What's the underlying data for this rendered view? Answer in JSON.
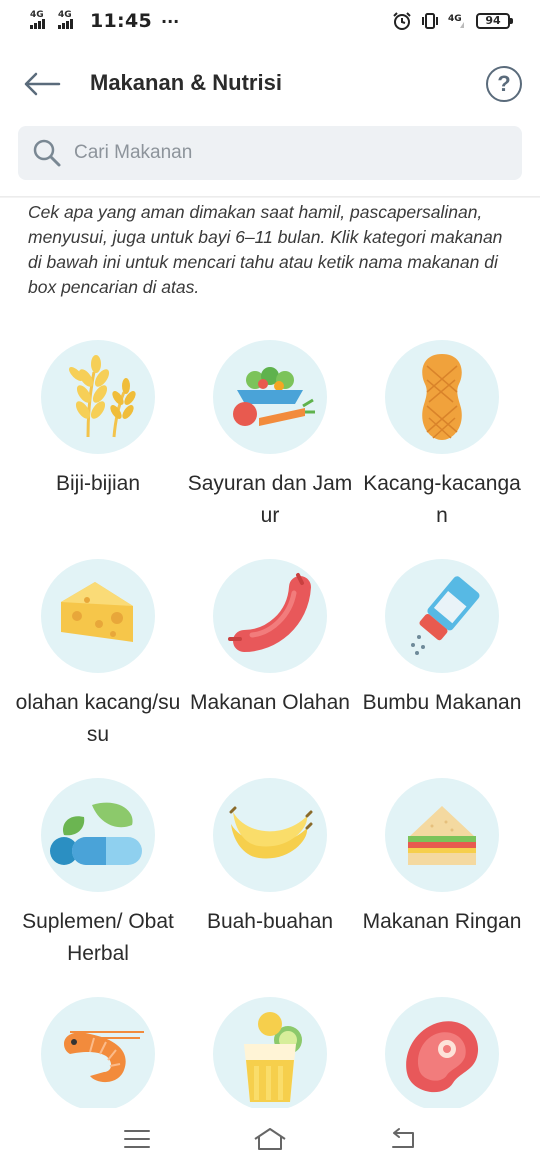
{
  "status_bar": {
    "network_1": "4G",
    "network_2": "4G",
    "time": "11:45",
    "more_dots": "···",
    "network_3": "4G",
    "battery": "94"
  },
  "header": {
    "title": "Makanan & Nutrisi",
    "help_label": "?"
  },
  "search": {
    "placeholder": "Cari Makanan"
  },
  "intro_text": "Cek apa yang aman dimakan saat hamil, pascapersalinan, menyusui, juga untuk bayi 6–11 bulan. Klik kategori makanan di bawah ini untuk mencari tahu atau ketik nama makanan di box pencarian di atas.",
  "categories": [
    {
      "label": "Biji-bijian",
      "icon": "wheat-icon"
    },
    {
      "label": "Sayuran dan Jamur",
      "icon": "vegetables-icon"
    },
    {
      "label": "Kacang-kacangan",
      "icon": "peanut-icon"
    },
    {
      "label": "olahan kacang/susu",
      "icon": "cheese-icon"
    },
    {
      "label": "Makanan Olahan",
      "icon": "sausage-icon"
    },
    {
      "label": "Bumbu Makanan",
      "icon": "salt-shaker-icon"
    },
    {
      "label": "Suplemen/ Obat Herbal",
      "icon": "pill-leaf-icon"
    },
    {
      "label": "Buah-buahan",
      "icon": "banana-icon"
    },
    {
      "label": "Makanan Ringan",
      "icon": "sandwich-icon"
    },
    {
      "label": "",
      "icon": "shrimp-icon"
    },
    {
      "label": "",
      "icon": "drink-icon"
    },
    {
      "label": "",
      "icon": "meat-icon"
    }
  ],
  "colors": {
    "circle_bg": "#e2f3f6",
    "search_bg": "#eef1f4",
    "text": "#2b2b2b"
  }
}
